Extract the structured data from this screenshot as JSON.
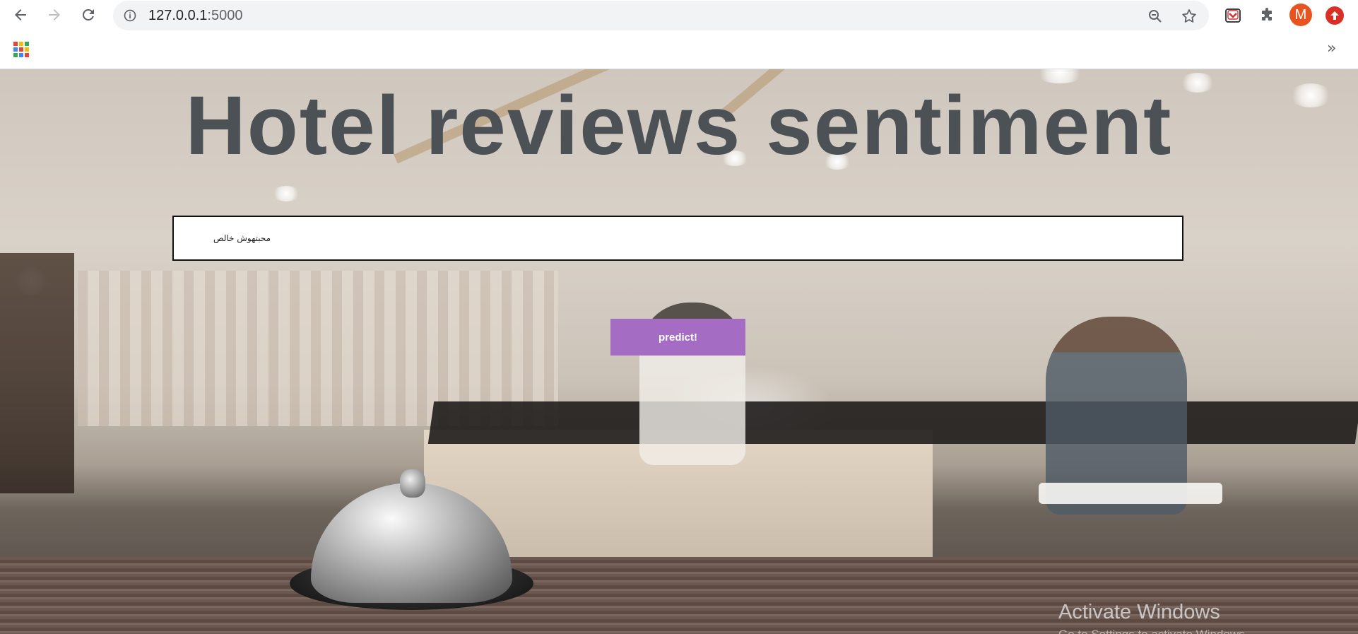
{
  "browser": {
    "url_host": "127.0.0.1",
    "url_port": ":5000",
    "avatar_letter": "M",
    "bookmarks_more": "»"
  },
  "page": {
    "title": "Hotel reviews sentiment",
    "review_input_value": "محبتهوش خالص",
    "predict_label": "predict!",
    "predict_color": "#a56cc3",
    "title_color": "#4b5155"
  },
  "os": {
    "watermark_title": "Activate Windows",
    "watermark_sub": "Go to Settings to activate Windows."
  }
}
